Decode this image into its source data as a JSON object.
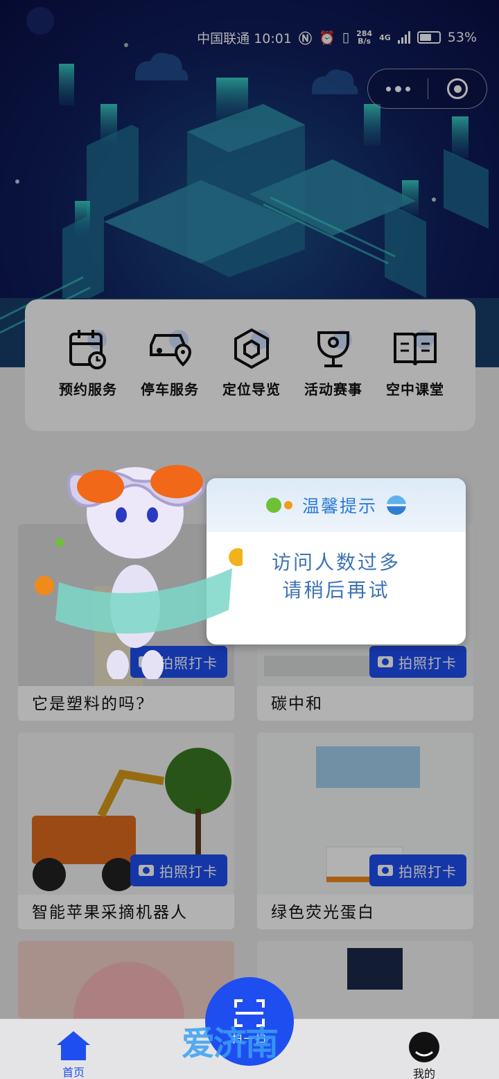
{
  "status_bar": {
    "carrier_time": "中国联通 10:01",
    "speed_value": "284",
    "speed_unit": "B/s",
    "network": "4G",
    "battery": "53%"
  },
  "capsule": {
    "more_icon": "more-dots-icon",
    "close_icon": "target-close-icon"
  },
  "services": [
    {
      "label": "预约服务",
      "icon": "calendar-clock-icon"
    },
    {
      "label": "停车服务",
      "icon": "car-location-icon"
    },
    {
      "label": "定位导览",
      "icon": "hexagon-locate-icon"
    },
    {
      "label": "活动赛事",
      "icon": "trophy-icon"
    },
    {
      "label": "空中课堂",
      "icon": "open-book-icon"
    }
  ],
  "cards": [
    {
      "title": "它是塑料的吗?",
      "checkin": "拍照打卡"
    },
    {
      "title": "碳中和",
      "checkin": "拍照打卡"
    },
    {
      "title": "智能苹果采摘机器人",
      "checkin": "拍照打卡"
    },
    {
      "title": "绿色荧光蛋白",
      "checkin": "拍照打卡"
    }
  ],
  "popup": {
    "title": "温馨提示",
    "line1": "访问人数过多",
    "line2": "请稍后再试"
  },
  "tabbar": {
    "home": "首页",
    "scan": "扫一扫",
    "mine": "我的"
  },
  "watermark": "爱济南",
  "colors": {
    "accent": "#1f4ef0",
    "popup_text": "#3c73b3",
    "popup_title": "#2d7bd6"
  }
}
